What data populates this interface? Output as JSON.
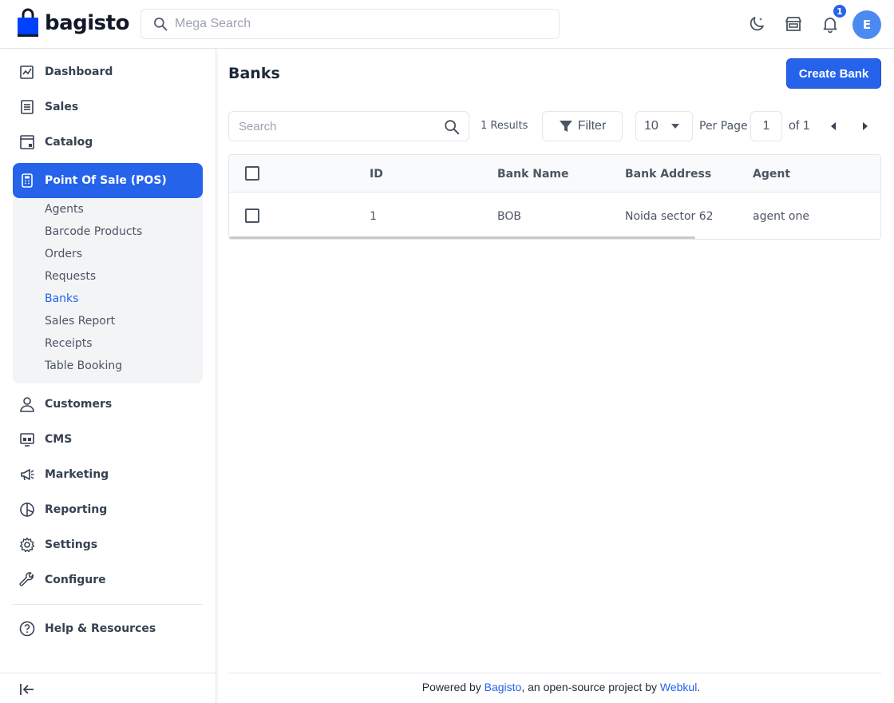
{
  "header": {
    "logo_text": "bagisto",
    "search_placeholder": "Mega Search",
    "notification_count": "1",
    "avatar_initial": "E"
  },
  "sidebar": {
    "items_top": [
      {
        "label": "Dashboard",
        "icon": "dashboard-icon"
      },
      {
        "label": "Sales",
        "icon": "sales-icon"
      },
      {
        "label": "Catalog",
        "icon": "catalog-icon"
      },
      {
        "label": "Point Of Sale (POS)",
        "icon": "pos-icon",
        "active": true
      }
    ],
    "pos_sub_items": [
      {
        "label": "Agents"
      },
      {
        "label": "Barcode Products"
      },
      {
        "label": "Orders"
      },
      {
        "label": "Requests"
      },
      {
        "label": "Banks",
        "active": true
      },
      {
        "label": "Sales Report"
      },
      {
        "label": "Receipts"
      },
      {
        "label": "Table Booking"
      }
    ],
    "items_bottom": [
      {
        "label": "Customers",
        "icon": "customers-icon"
      },
      {
        "label": "CMS",
        "icon": "cms-icon"
      },
      {
        "label": "Marketing",
        "icon": "marketing-icon"
      },
      {
        "label": "Reporting",
        "icon": "reporting-icon"
      },
      {
        "label": "Settings",
        "icon": "settings-icon"
      },
      {
        "label": "Configure",
        "icon": "configure-icon"
      }
    ],
    "help": {
      "label": "Help & Resources",
      "icon": "help-icon"
    }
  },
  "main": {
    "title": "Banks",
    "create_button": "Create Bank",
    "search_placeholder": "Search",
    "results": "1 Results",
    "filter_label": "Filter",
    "per_page_value": "10",
    "per_page_label": "Per Page",
    "current_page": "1",
    "page_of": "of 1",
    "table": {
      "columns": [
        "ID",
        "Bank Name",
        "Bank Address",
        "Agent"
      ],
      "rows": [
        {
          "id": "1",
          "bank_name": "BOB",
          "bank_address": "Noida sector 62",
          "agent": "agent one"
        }
      ]
    }
  },
  "footer": {
    "prefix": "Powered by ",
    "link1": "Bagisto",
    "middle": ", an open-source project by ",
    "link2": "Webkul",
    "suffix": "."
  },
  "colors": {
    "accent": "#2563eb",
    "logo_bag": "#0041ff"
  }
}
